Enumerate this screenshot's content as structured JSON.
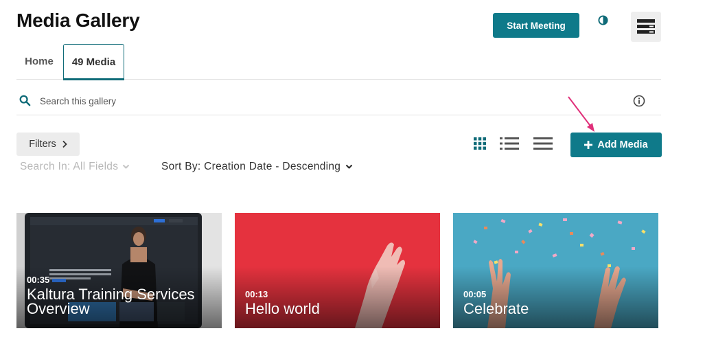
{
  "header": {
    "title": "Media Gallery",
    "start_meeting_label": "Start Meeting",
    "contrast_icon": "contrast-icon",
    "user_menu_icon": "user-menu-icon"
  },
  "tabs": [
    {
      "label": "Home",
      "active": false
    },
    {
      "label": "49 Media",
      "active": true
    }
  ],
  "search": {
    "placeholder": "Search this gallery",
    "value": ""
  },
  "toolbar": {
    "filters_label": "Filters",
    "add_media_label": "Add Media",
    "view_modes": [
      "grid",
      "details",
      "compact"
    ],
    "active_view": "grid",
    "search_in_label": "Search In: All Fields",
    "sort_by_label": "Sort By: Creation Date - Descending"
  },
  "media": [
    {
      "duration": "00:35",
      "title": "Kaltura Training Services Overview"
    },
    {
      "duration": "00:13",
      "title": "Hello world"
    },
    {
      "duration": "00:05",
      "title": "Celebrate"
    }
  ],
  "colors": {
    "accent": "#0f7a8a",
    "annotation_arrow": "#e0307a"
  }
}
